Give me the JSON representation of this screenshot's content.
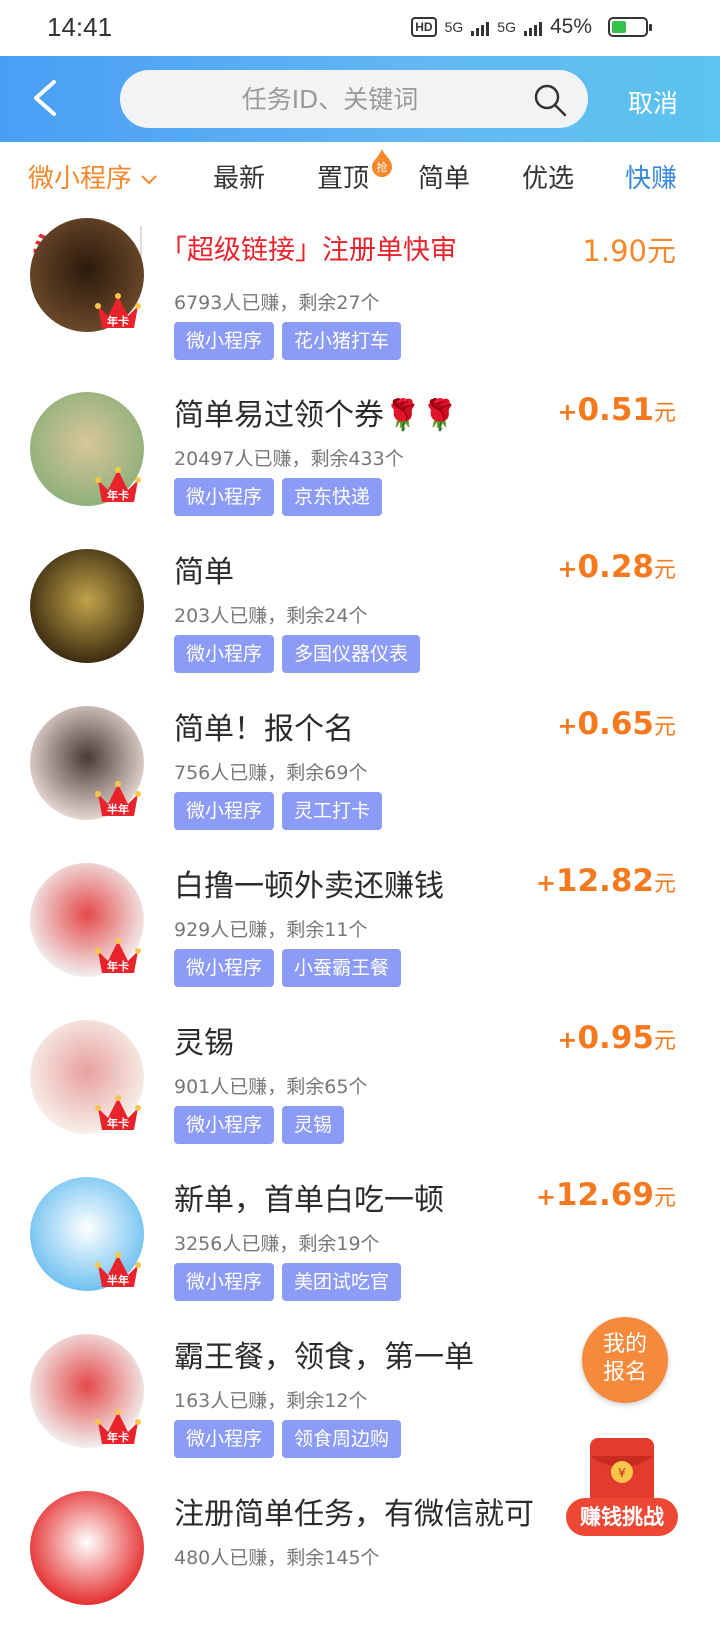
{
  "status_bar": {
    "time": "14:41",
    "network1": "5G",
    "network2": "5G",
    "hd": "HD",
    "battery_percent": "45%",
    "battery_level": 0.45
  },
  "header": {
    "search_placeholder": "任务ID、关键词",
    "cancel_label": "取消"
  },
  "tabs": [
    {
      "label": "微小程序",
      "active": true
    },
    {
      "label": "最新"
    },
    {
      "label": "置顶",
      "badge": "抢"
    },
    {
      "label": "简单"
    },
    {
      "label": "优选"
    },
    {
      "label": "快赚"
    }
  ],
  "headline": {
    "logo": "头条",
    "title": "「超级链接」注册单快审",
    "reward": "1.90元"
  },
  "items": [
    {
      "title": "",
      "stats": "6793人已赚，剩余27个",
      "tags": [
        "微小程序",
        "花小猪打车"
      ],
      "price": "",
      "crown": "年卡"
    },
    {
      "title": "简单易过领个券🌹🌹",
      "stats": "20497人已赚，剩余433个",
      "tags": [
        "微小程序",
        "京东快递"
      ],
      "price": "0.51",
      "crown": "年卡"
    },
    {
      "title": "简单",
      "stats": "203人已赚，剩余24个",
      "tags": [
        "微小程序",
        "多国仪器仪表"
      ],
      "price": "0.28",
      "crown": ""
    },
    {
      "title": "简单！报个名",
      "stats": "756人已赚，剩余69个",
      "tags": [
        "微小程序",
        "灵工打卡"
      ],
      "price": "0.65",
      "crown": "半年"
    },
    {
      "title": "白撸一顿外卖还赚钱",
      "stats": "929人已赚，剩余11个",
      "tags": [
        "微小程序",
        "小蚕霸王餐"
      ],
      "price": "12.82",
      "crown": "年卡"
    },
    {
      "title": "灵锡",
      "stats": "901人已赚，剩余65个",
      "tags": [
        "微小程序",
        "灵锡"
      ],
      "price": "0.95",
      "crown": "年卡"
    },
    {
      "title": "新单，首单白吃一顿",
      "stats": "3256人已赚，剩余19个",
      "tags": [
        "微小程序",
        "美团试吃官"
      ],
      "price": "12.69",
      "crown": "半年"
    },
    {
      "title": "霸王餐，领食，第一单",
      "stats": "163人已赚，剩余12个",
      "tags": [
        "微小程序",
        "领食周边购"
      ],
      "price": "",
      "crown": "年卡"
    },
    {
      "title": "注册简单任务，有微信就可",
      "stats": "480人已赚，剩余145个",
      "tags": [],
      "price": "",
      "crown": ""
    }
  ],
  "price_plus": "+",
  "price_unit": "元",
  "floating": {
    "signup_line1": "我的",
    "signup_line2": "报名",
    "challenge_label": "赚钱挑战"
  },
  "colors": {
    "header_blue": "#4a9ef5",
    "tag_purple": "#8c9bf5",
    "price_orange": "#f57a1f",
    "headline_red": "#e8232c",
    "active_tab_orange": "#f5882b",
    "fast_tab_blue": "#3b8ad9"
  }
}
